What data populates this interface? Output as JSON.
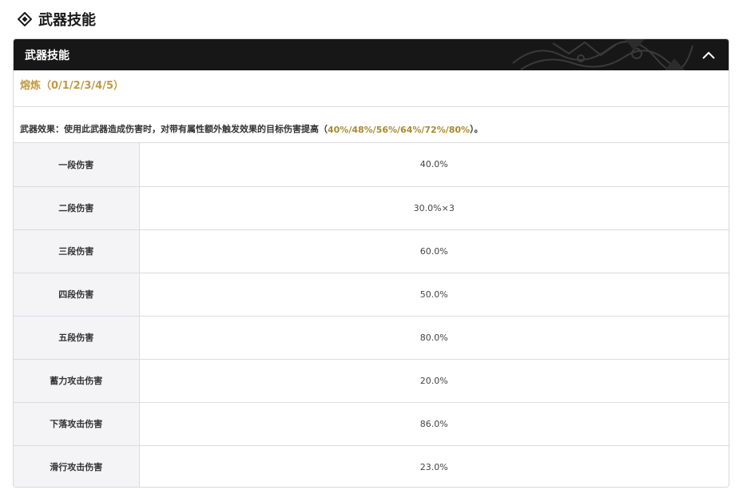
{
  "section": {
    "title": "武器技能",
    "icon": "diamond-icon"
  },
  "panel": {
    "title": "武器技能",
    "collapse_icon": "chevron-up-icon",
    "refine_label": "熔炼（0/1/2/3/4/5）",
    "effect_prefix": "武器效果：使用此武器造成伤害时，对带有属性额外触发效果的目标伤害提高（",
    "effect_values": "40%/48%/56%/64%/72%/80%",
    "effect_suffix": "）。",
    "accent_color": "#c09a45"
  },
  "stats": [
    {
      "label": "一段伤害",
      "value": "40.0%"
    },
    {
      "label": "二段伤害",
      "value": "30.0%×3"
    },
    {
      "label": "三段伤害",
      "value": "60.0%"
    },
    {
      "label": "四段伤害",
      "value": "50.0%"
    },
    {
      "label": "五段伤害",
      "value": "80.0%"
    },
    {
      "label": "蓄力攻击伤害",
      "value": "20.0%"
    },
    {
      "label": "下落攻击伤害",
      "value": "86.0%"
    },
    {
      "label": "滑行攻击伤害",
      "value": "23.0%"
    }
  ]
}
